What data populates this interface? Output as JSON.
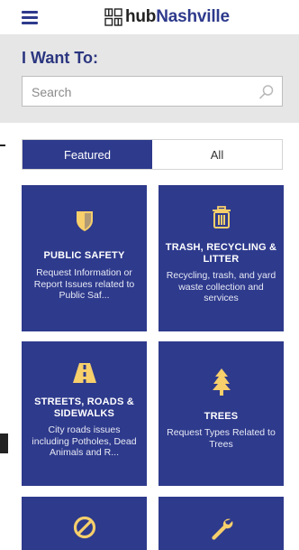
{
  "header": {
    "menu_icon": "hamburger-menu-icon",
    "logo_mark_icon": "hub-grid-logo-icon",
    "logo_prefix": "hub",
    "logo_brand": "Nashville"
  },
  "want": {
    "title": "I Want To:",
    "search_placeholder": "Search",
    "search_icon": "search-icon"
  },
  "tabs": [
    {
      "label": "Featured",
      "active": true
    },
    {
      "label": "All",
      "active": false
    }
  ],
  "tiles": [
    {
      "icon": "shield-icon",
      "title": "PUBLIC SAFETY",
      "desc": "Request Information or Report Issues related to Public Saf..."
    },
    {
      "icon": "trash-can-icon",
      "title": "TRASH, RECYCLING & LITTER",
      "desc": "Recycling, trash, and yard waste collection and services"
    },
    {
      "icon": "road-icon",
      "title": "STREETS, ROADS & SIDEWALKS",
      "desc": "City roads issues including Potholes, Dead Animals and R..."
    },
    {
      "icon": "tree-icon",
      "title": "TREES",
      "desc": "Request Types Related to Trees"
    },
    {
      "icon": "prohibited-icon",
      "title": "",
      "desc": ""
    },
    {
      "icon": "wrench-icon",
      "title": "",
      "desc": ""
    }
  ],
  "colors": {
    "brand": "#2e3a8c",
    "icon_yellow": "#f7cf6b",
    "panel_gray": "#e6e6e6"
  }
}
